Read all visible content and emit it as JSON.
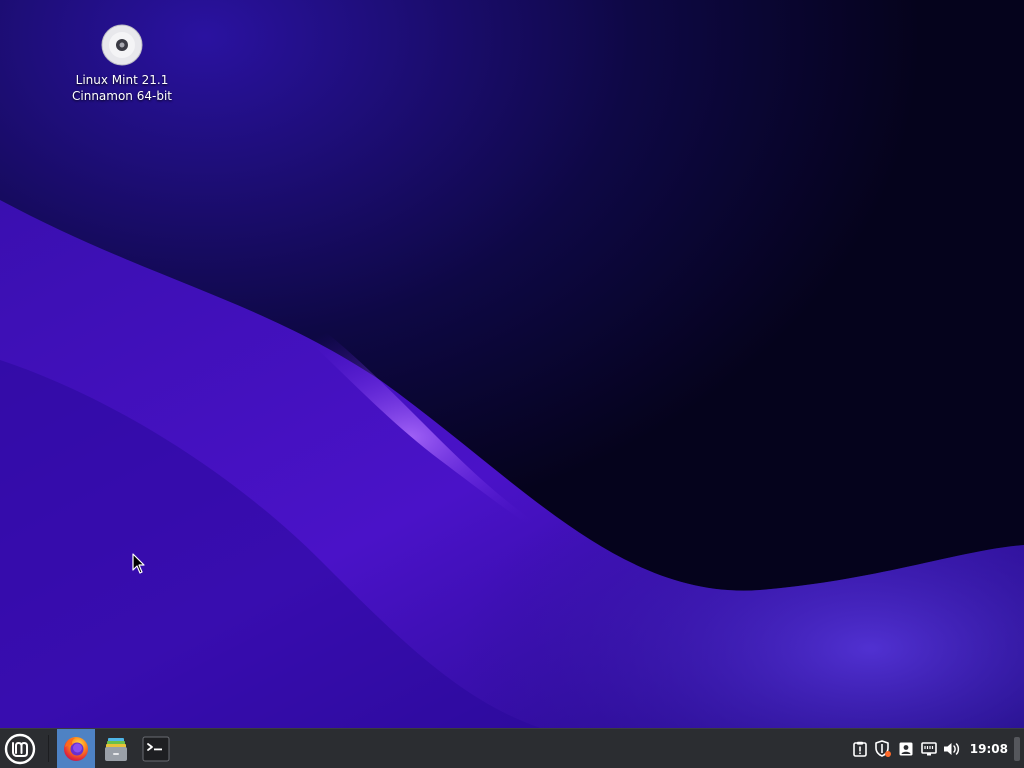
{
  "desktop": {
    "icon": {
      "name": "cdrom-icon",
      "label_line1": "Linux Mint 21.1",
      "label_line2": "Cinnamon 64-bit"
    },
    "wallpaper_colors": {
      "base": "#0a0630",
      "wave": "#5a1fd0",
      "highlight": "#a35cf0",
      "deep": "#1a0a78"
    }
  },
  "taskbar": {
    "background": "#2b2d31",
    "active_color": "#4e82c4",
    "menu_button_icon": "linux-mint-logo-icon",
    "launchers": [
      {
        "name": "firefox",
        "icon": "firefox-icon",
        "active": true
      },
      {
        "name": "files",
        "icon": "file-manager-icon",
        "active": false
      },
      {
        "name": "terminal",
        "icon": "terminal-icon",
        "active": false
      }
    ],
    "tray_icons": [
      "update-manager-icon",
      "security-shield-icon",
      "user-icon",
      "network-icon",
      "volume-icon"
    ],
    "clock": "19:08"
  }
}
